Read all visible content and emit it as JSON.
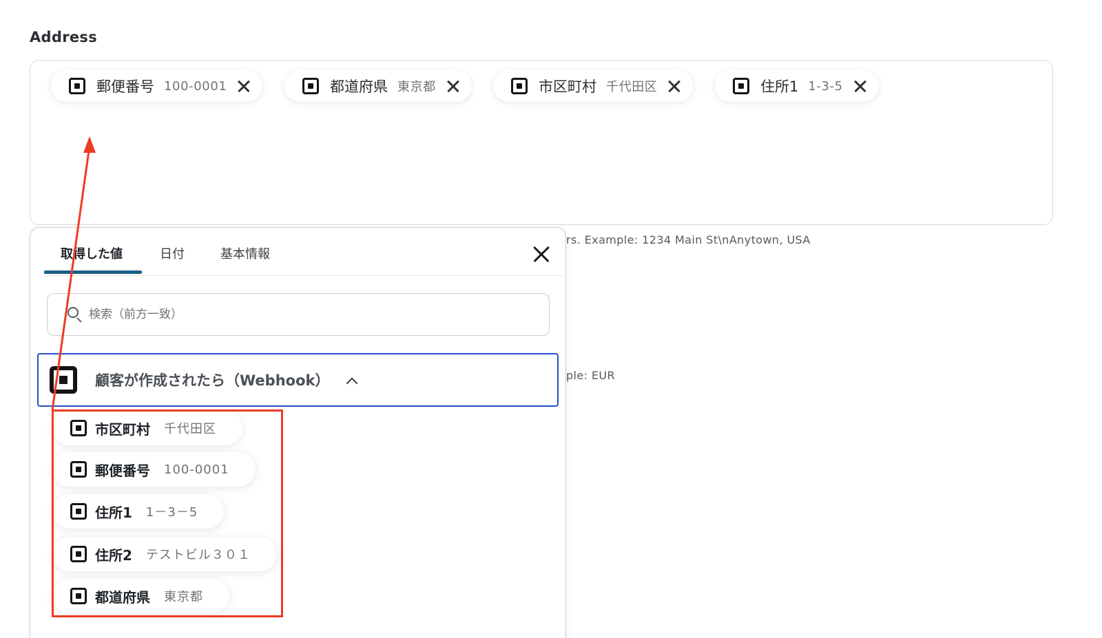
{
  "field": {
    "label": "Address",
    "helper_text": "rs. Example: 1234 Main St\\nAnytown, USA",
    "helper_text_2": "ple: EUR"
  },
  "chips": [
    {
      "label": "郵便番号",
      "value": "100-0001"
    },
    {
      "label": "都道府県",
      "value": "東京都"
    },
    {
      "label": "市区町村",
      "value": "千代田区"
    },
    {
      "label": "住所1",
      "value": "1-3-5"
    }
  ],
  "popup": {
    "tabs": [
      {
        "label": "取得した値",
        "active": true
      },
      {
        "label": "日付",
        "active": false
      },
      {
        "label": "基本情報",
        "active": false
      }
    ],
    "search": {
      "placeholder": "検索（前方一致）"
    },
    "source": {
      "title": "顧客が作成されたら（Webhook）",
      "expanded": true
    },
    "values": [
      {
        "label": "市区町村",
        "value": "千代田区"
      },
      {
        "label": "郵便番号",
        "value": "100-0001"
      },
      {
        "label": "住所1",
        "value": "1－3－5"
      },
      {
        "label": "住所2",
        "value": "テストビル３０１"
      },
      {
        "label": "都道府県",
        "value": "東京都"
      }
    ]
  },
  "icons": {
    "chip_icon": "square-app-icon",
    "remove": "close-icon",
    "search": "search-icon",
    "chevron": "chevron-up-icon"
  },
  "colors": {
    "tab_indicator": "#1b5e86",
    "selected_border": "#2450c8",
    "annotation": "#ee3b24"
  }
}
